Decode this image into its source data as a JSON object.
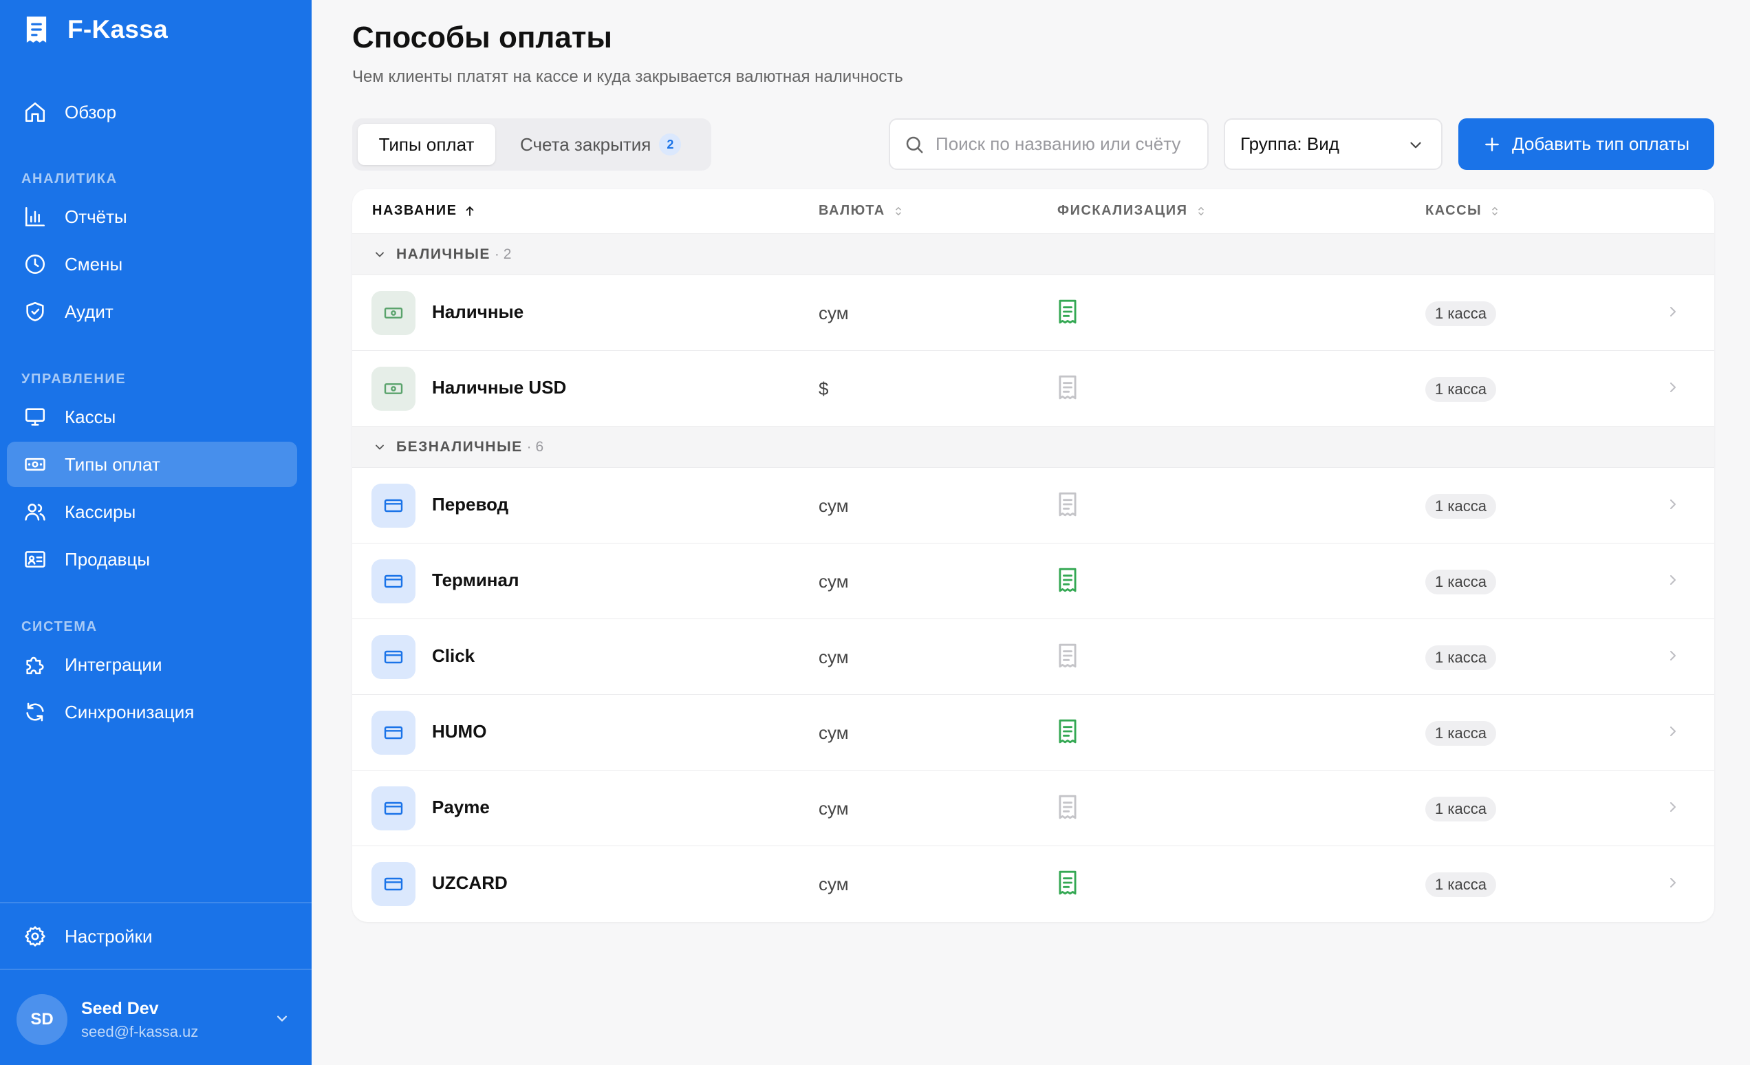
{
  "app": {
    "name": "F-Kassa"
  },
  "colors": {
    "accent": "#1a73e8",
    "fiscal_on": "#34a853",
    "fiscal_off": "#c4c4c8"
  },
  "sidebar": {
    "items": [
      {
        "label": "Обзор",
        "icon": "home-icon"
      },
      {
        "label": "Отчёты",
        "icon": "bar-chart-icon"
      },
      {
        "label": "Смены",
        "icon": "clock-icon"
      },
      {
        "label": "Аудит",
        "icon": "shield-check-icon"
      },
      {
        "label": "Кассы",
        "icon": "monitor-icon"
      },
      {
        "label": "Типы оплат",
        "icon": "banknote-icon",
        "active": true
      },
      {
        "label": "Кассиры",
        "icon": "users-icon"
      },
      {
        "label": "Продавцы",
        "icon": "id-card-icon"
      },
      {
        "label": "Интеграции",
        "icon": "puzzle-icon"
      },
      {
        "label": "Синхронизация",
        "icon": "refresh-icon"
      }
    ],
    "sections": {
      "analytics": "АНАЛИТИКА",
      "management": "УПРАВЛЕНИЕ",
      "system": "СИСТЕМА"
    },
    "settings": {
      "label": "Настройки",
      "icon": "gear-icon"
    },
    "user": {
      "initials": "SD",
      "name": "Seed Dev",
      "email": "seed@f-kassa.uz"
    }
  },
  "page": {
    "title": "Способы оплаты",
    "subtitle": "Чем клиенты платят на кассе и куда закрывается валютная наличность"
  },
  "tabs": [
    {
      "label": "Типы оплат",
      "active": true
    },
    {
      "label": "Счета закрытия",
      "badge": "2"
    }
  ],
  "toolbar": {
    "search_placeholder": "Поиск по названию или счёту",
    "group_select": "Группа: Вид",
    "add_button": "Добавить тип оплаты"
  },
  "table": {
    "columns": {
      "name": "НАЗВАНИЕ",
      "currency": "ВАЛЮТА",
      "fiscal": "ФИСКАЛИЗАЦИЯ",
      "kassy": "КАССЫ"
    },
    "sort": {
      "column": "name",
      "direction": "asc"
    },
    "groups": [
      {
        "label": "НАЛИЧНЫЕ",
        "count": "· 2",
        "rows": [
          {
            "name": "Наличные",
            "currency": "сум",
            "fiscal": true,
            "kassy": "1 касса",
            "type": "cash"
          },
          {
            "name": "Наличные USD",
            "currency": "$",
            "fiscal": false,
            "kassy": "1 касса",
            "type": "cash"
          }
        ]
      },
      {
        "label": "БЕЗНАЛИЧНЫЕ",
        "count": "· 6",
        "rows": [
          {
            "name": "Перевод",
            "currency": "сум",
            "fiscal": false,
            "kassy": "1 касса",
            "type": "card"
          },
          {
            "name": "Терминал",
            "currency": "сум",
            "fiscal": true,
            "kassy": "1 касса",
            "type": "card"
          },
          {
            "name": "Click",
            "currency": "сум",
            "fiscal": false,
            "kassy": "1 касса",
            "type": "card"
          },
          {
            "name": "HUMO",
            "currency": "сум",
            "fiscal": true,
            "kassy": "1 касса",
            "type": "card"
          },
          {
            "name": "Payme",
            "currency": "сум",
            "fiscal": false,
            "kassy": "1 касса",
            "type": "card"
          },
          {
            "name": "UZCARD",
            "currency": "сум",
            "fiscal": true,
            "kassy": "1 касса",
            "type": "card"
          }
        ]
      }
    ]
  }
}
